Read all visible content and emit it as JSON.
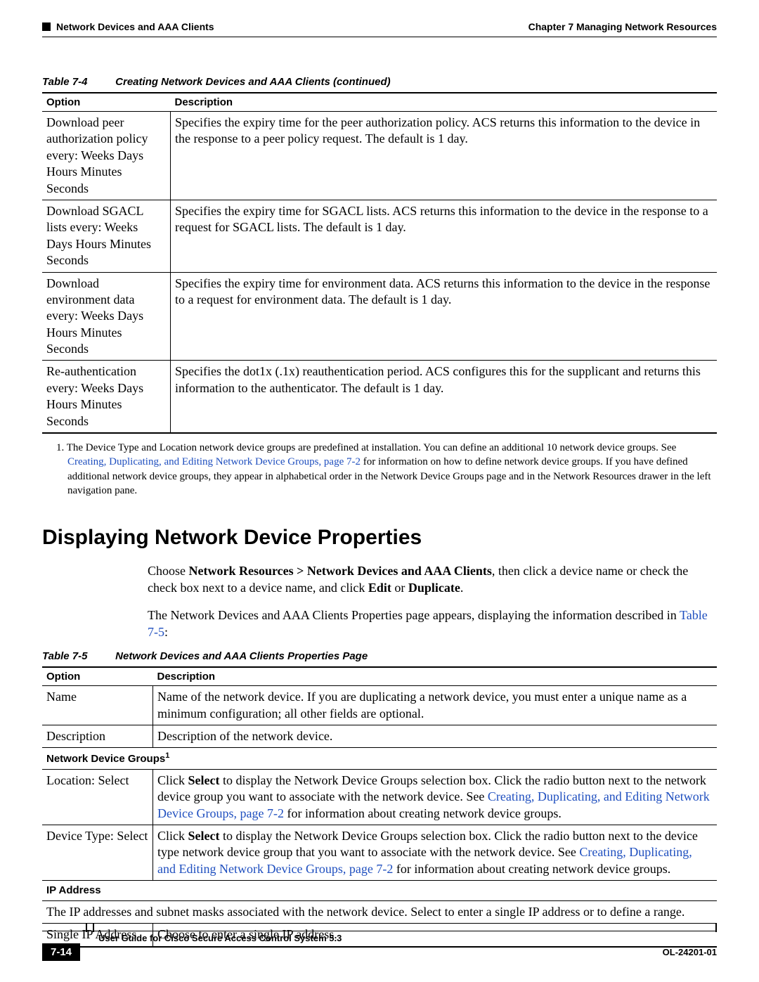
{
  "header": {
    "section": "Network Devices and AAA Clients",
    "chapter": "Chapter 7    Managing Network Resources"
  },
  "table74": {
    "caption_num": "Table 7-4",
    "caption_text": "Creating Network Devices and AAA Clients (continued)",
    "head_option": "Option",
    "head_desc": "Description",
    "rows": [
      {
        "option": "Download peer authorization policy every: Weeks Days Hours Minutes Seconds",
        "desc": "Specifies the expiry time for the peer authorization policy. ACS returns this information to the device in the response to a peer policy request. The default is 1 day."
      },
      {
        "option": "Download SGACL lists every: Weeks Days Hours Minutes Seconds",
        "desc": "Specifies the expiry time for SGACL lists. ACS returns this information to the device in the response to a request for SGACL lists. The default is 1 day."
      },
      {
        "option": "Download environment data every: Weeks Days Hours Minutes Seconds",
        "desc": "Specifies the expiry time for environment data. ACS returns this information to the device in the response to a request for environment data. The default is 1 day."
      },
      {
        "option": "Re-authentication every: Weeks Days Hours Minutes Seconds",
        "desc": "Specifies the dot1x (.1x) reauthentication period. ACS configures this for the supplicant and returns this information to the authenticator. The default is 1 day."
      }
    ]
  },
  "footnote74": {
    "num": "1.",
    "pre": "The Device Type and Location network device groups are predefined at installation. You can define an additional 10 network device groups. See ",
    "link": "Creating, Duplicating, and Editing Network Device Groups, page 7-2",
    "post": " for information on how to define network device groups. If you have defined additional network device groups, they appear in alphabetical order in the Network Device Groups page and in the Network Resources drawer in the left navigation pane."
  },
  "section": {
    "title": "Displaying Network Device Properties",
    "p1_pre": "Choose ",
    "p1_bold1": "Network Resources > Network Devices and AAA Clients",
    "p1_mid": ", then click a device name or check the check box next to a device name, and click ",
    "p1_bold2": "Edit",
    "p1_or": " or ",
    "p1_bold3": "Duplicate",
    "p1_end": ".",
    "p2_pre": "The Network Devices and AAA Clients Properties page appears, displaying the information described in ",
    "p2_link": "Table 7-5",
    "p2_end": ":"
  },
  "table75": {
    "caption_num": "Table 7-5",
    "caption_text": "Network Devices and AAA Clients Properties Page",
    "head_option": "Option",
    "head_desc": "Description",
    "r_name_o": "Name",
    "r_name_d": "Name of the network device. If you are duplicating a network device, you must enter a unique name as a minimum configuration; all other fields are optional.",
    "r_desc_o": "Description",
    "r_desc_d": "Description of the network device.",
    "sec_ndg": "Network Device Groups",
    "r_loc_o": "Location: Select",
    "r_loc_pre": "Click ",
    "r_loc_b": "Select",
    "r_loc_mid": " to display the Network Device Groups selection box. Click the radio button next to the network device group you want to associate with the network device. See ",
    "r_loc_link": "Creating, Duplicating, and Editing Network Device Groups, page 7-2",
    "r_loc_post": " for information about creating network device groups.",
    "r_dt_o": "Device Type: Select",
    "r_dt_pre": "Click ",
    "r_dt_b": "Select",
    "r_dt_mid": " to display the Network Device Groups selection box. Click the radio button next to the device type network device group that you want to associate with the network device. See ",
    "r_dt_link": "Creating, Duplicating, and Editing Network Device Groups, page 7-2",
    "r_dt_post": " for information about creating network device groups.",
    "sec_ip": "IP Address",
    "ip_intro": "The IP addresses and subnet masks associated with the network device. Select to enter a single IP address or to define a range.",
    "r_sip_o": "Single IP Address",
    "r_sip_d": "Choose to enter a single IP address."
  },
  "footer": {
    "guide": "User Guide for Cisco Secure Access Control System 5.3",
    "page": "7-14",
    "doc": "OL-24201-01"
  }
}
